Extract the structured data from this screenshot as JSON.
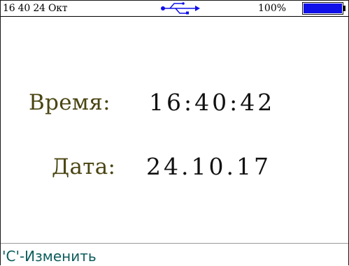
{
  "status_bar": {
    "datetime": "16 40 24 Окт",
    "usb_icon": "usb-icon",
    "battery_percent": "100%",
    "battery_icon": "battery-full-icon",
    "battery_level": 1.0,
    "battery_color": "#1010e8"
  },
  "main": {
    "time_label": "Время:",
    "time_value": "16:40:42",
    "date_label": "Дата:",
    "date_value": "24.10.17"
  },
  "footer": {
    "hint": "'С'-Изменить"
  },
  "colors": {
    "label": "#4a4512",
    "value": "#111111",
    "hint": "#0d5c5c"
  }
}
